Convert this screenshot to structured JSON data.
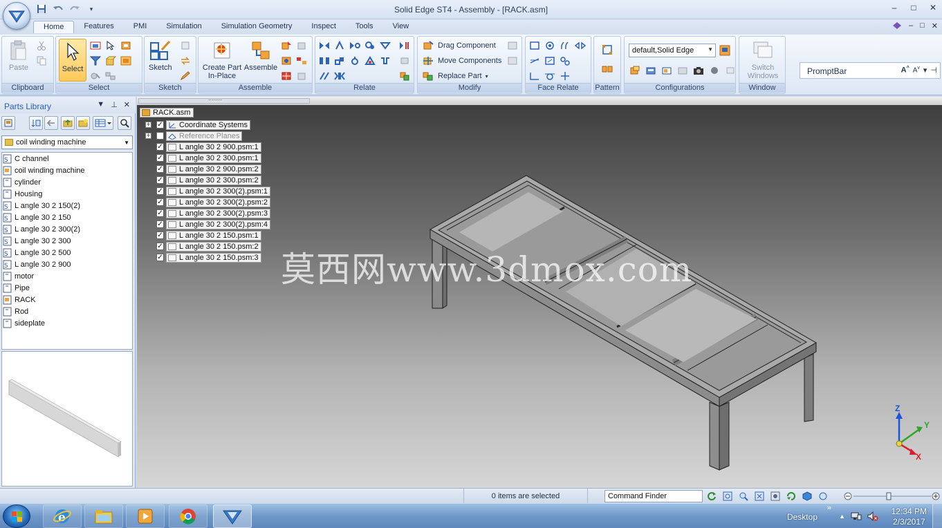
{
  "window": {
    "title": "Solid Edge ST4 - Assembly - [RACK.asm]",
    "controls": [
      "–",
      "□",
      "✕"
    ]
  },
  "ribbon_tabs": [
    "Home",
    "Features",
    "PMI",
    "Simulation",
    "Simulation Geometry",
    "Inspect",
    "Tools",
    "View"
  ],
  "ribbon": {
    "clipboard": {
      "label": "Clipboard",
      "paste": "Paste"
    },
    "select": {
      "label": "Select",
      "select": "Select"
    },
    "sketch": {
      "label": "Sketch",
      "sketch": "Sketch"
    },
    "assemble": {
      "label": "Assemble",
      "create_part": "Create Part\nIn-Place",
      "assemble": "Assemble"
    },
    "relate": {
      "label": "Relate"
    },
    "modify": {
      "label": "Modify",
      "drag": "Drag Component",
      "move": "Move Components",
      "replace": "Replace Part"
    },
    "face_relate": {
      "label": "Face Relate"
    },
    "pattern": {
      "label": "Pattern"
    },
    "configurations": {
      "label": "Configurations",
      "combo_value": "default,Solid Edge"
    },
    "window": {
      "label": "Window",
      "switch": "Switch\nWindows"
    }
  },
  "promptbar": {
    "label": "PromptBar"
  },
  "parts_library": {
    "title": "Parts Library",
    "folder": "coil winding machine",
    "items": [
      "C channel",
      "coil winding machine",
      "cylinder",
      "Housing",
      "L angle 30 2 150(2)",
      "L angle 30 2 150",
      "L angle 30 2 300(2)",
      "L angle 30 2 300",
      "L angle 30 2 500",
      "L angle 30 2 900",
      "motor",
      "Pipe",
      "RACK",
      "Rod",
      "sideplate"
    ]
  },
  "tree": {
    "root": "RACK.asm",
    "coordinate_systems": "Coordinate Systems",
    "reference_planes": "Reference Planes",
    "parts": [
      "L angle 30 2 900.psm:1",
      "L angle 30 2 300.psm:1",
      "L angle 30 2 900.psm:2",
      "L angle 30 2 300.psm:2",
      "L angle 30 2 300(2).psm:1",
      "L angle 30 2 300(2).psm:2",
      "L angle 30 2 300(2).psm:3",
      "L angle 30 2 300(2).psm:4",
      "L angle 30 2 150.psm:1",
      "L angle 30 2 150.psm:2",
      "L angle 30 2 150.psm:3"
    ]
  },
  "watermark": "莫西网www.3dmox.com",
  "triad": {
    "z": "Z",
    "y": "Y",
    "x": "X"
  },
  "status": {
    "selection": "0 items are selected",
    "command_finder_placeholder": "Command Finder"
  },
  "taskbar": {
    "desktop": "Desktop",
    "time": "12:34 PM",
    "date": "2/3/2017"
  },
  "colors": {
    "ribbon_bg": "#dde7f4",
    "select_highlight": "#ffc959",
    "viewport_top": "#3c3c3c",
    "viewport_bottom": "#d6d6d6",
    "triad_x": "#d8202a",
    "triad_y": "#2fa52a",
    "triad_z": "#1a56d6"
  }
}
